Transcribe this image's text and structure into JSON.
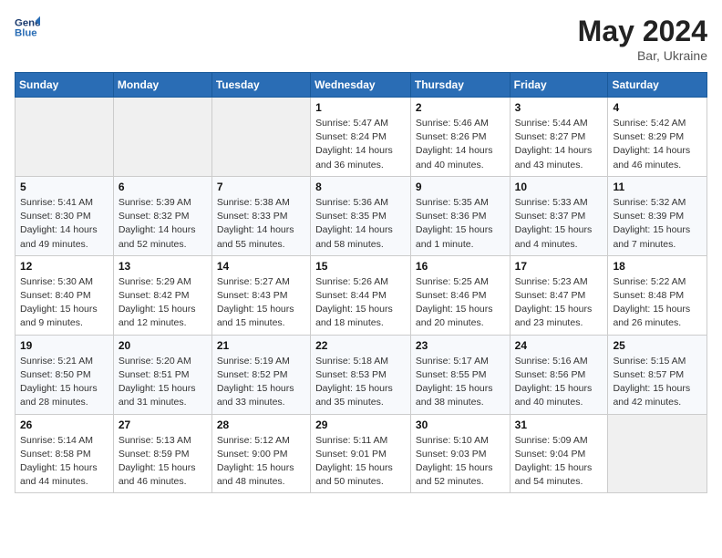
{
  "header": {
    "logo_line1": "General",
    "logo_line2": "Blue",
    "month_year": "May 2024",
    "location": "Bar, Ukraine"
  },
  "days_of_week": [
    "Sunday",
    "Monday",
    "Tuesday",
    "Wednesday",
    "Thursday",
    "Friday",
    "Saturday"
  ],
  "weeks": [
    [
      {
        "num": "",
        "info": ""
      },
      {
        "num": "",
        "info": ""
      },
      {
        "num": "",
        "info": ""
      },
      {
        "num": "1",
        "info": "Sunrise: 5:47 AM\nSunset: 8:24 PM\nDaylight: 14 hours\nand 36 minutes."
      },
      {
        "num": "2",
        "info": "Sunrise: 5:46 AM\nSunset: 8:26 PM\nDaylight: 14 hours\nand 40 minutes."
      },
      {
        "num": "3",
        "info": "Sunrise: 5:44 AM\nSunset: 8:27 PM\nDaylight: 14 hours\nand 43 minutes."
      },
      {
        "num": "4",
        "info": "Sunrise: 5:42 AM\nSunset: 8:29 PM\nDaylight: 14 hours\nand 46 minutes."
      }
    ],
    [
      {
        "num": "5",
        "info": "Sunrise: 5:41 AM\nSunset: 8:30 PM\nDaylight: 14 hours\nand 49 minutes."
      },
      {
        "num": "6",
        "info": "Sunrise: 5:39 AM\nSunset: 8:32 PM\nDaylight: 14 hours\nand 52 minutes."
      },
      {
        "num": "7",
        "info": "Sunrise: 5:38 AM\nSunset: 8:33 PM\nDaylight: 14 hours\nand 55 minutes."
      },
      {
        "num": "8",
        "info": "Sunrise: 5:36 AM\nSunset: 8:35 PM\nDaylight: 14 hours\nand 58 minutes."
      },
      {
        "num": "9",
        "info": "Sunrise: 5:35 AM\nSunset: 8:36 PM\nDaylight: 15 hours\nand 1 minute."
      },
      {
        "num": "10",
        "info": "Sunrise: 5:33 AM\nSunset: 8:37 PM\nDaylight: 15 hours\nand 4 minutes."
      },
      {
        "num": "11",
        "info": "Sunrise: 5:32 AM\nSunset: 8:39 PM\nDaylight: 15 hours\nand 7 minutes."
      }
    ],
    [
      {
        "num": "12",
        "info": "Sunrise: 5:30 AM\nSunset: 8:40 PM\nDaylight: 15 hours\nand 9 minutes."
      },
      {
        "num": "13",
        "info": "Sunrise: 5:29 AM\nSunset: 8:42 PM\nDaylight: 15 hours\nand 12 minutes."
      },
      {
        "num": "14",
        "info": "Sunrise: 5:27 AM\nSunset: 8:43 PM\nDaylight: 15 hours\nand 15 minutes."
      },
      {
        "num": "15",
        "info": "Sunrise: 5:26 AM\nSunset: 8:44 PM\nDaylight: 15 hours\nand 18 minutes."
      },
      {
        "num": "16",
        "info": "Sunrise: 5:25 AM\nSunset: 8:46 PM\nDaylight: 15 hours\nand 20 minutes."
      },
      {
        "num": "17",
        "info": "Sunrise: 5:23 AM\nSunset: 8:47 PM\nDaylight: 15 hours\nand 23 minutes."
      },
      {
        "num": "18",
        "info": "Sunrise: 5:22 AM\nSunset: 8:48 PM\nDaylight: 15 hours\nand 26 minutes."
      }
    ],
    [
      {
        "num": "19",
        "info": "Sunrise: 5:21 AM\nSunset: 8:50 PM\nDaylight: 15 hours\nand 28 minutes."
      },
      {
        "num": "20",
        "info": "Sunrise: 5:20 AM\nSunset: 8:51 PM\nDaylight: 15 hours\nand 31 minutes."
      },
      {
        "num": "21",
        "info": "Sunrise: 5:19 AM\nSunset: 8:52 PM\nDaylight: 15 hours\nand 33 minutes."
      },
      {
        "num": "22",
        "info": "Sunrise: 5:18 AM\nSunset: 8:53 PM\nDaylight: 15 hours\nand 35 minutes."
      },
      {
        "num": "23",
        "info": "Sunrise: 5:17 AM\nSunset: 8:55 PM\nDaylight: 15 hours\nand 38 minutes."
      },
      {
        "num": "24",
        "info": "Sunrise: 5:16 AM\nSunset: 8:56 PM\nDaylight: 15 hours\nand 40 minutes."
      },
      {
        "num": "25",
        "info": "Sunrise: 5:15 AM\nSunset: 8:57 PM\nDaylight: 15 hours\nand 42 minutes."
      }
    ],
    [
      {
        "num": "26",
        "info": "Sunrise: 5:14 AM\nSunset: 8:58 PM\nDaylight: 15 hours\nand 44 minutes."
      },
      {
        "num": "27",
        "info": "Sunrise: 5:13 AM\nSunset: 8:59 PM\nDaylight: 15 hours\nand 46 minutes."
      },
      {
        "num": "28",
        "info": "Sunrise: 5:12 AM\nSunset: 9:00 PM\nDaylight: 15 hours\nand 48 minutes."
      },
      {
        "num": "29",
        "info": "Sunrise: 5:11 AM\nSunset: 9:01 PM\nDaylight: 15 hours\nand 50 minutes."
      },
      {
        "num": "30",
        "info": "Sunrise: 5:10 AM\nSunset: 9:03 PM\nDaylight: 15 hours\nand 52 minutes."
      },
      {
        "num": "31",
        "info": "Sunrise: 5:09 AM\nSunset: 9:04 PM\nDaylight: 15 hours\nand 54 minutes."
      },
      {
        "num": "",
        "info": ""
      }
    ]
  ]
}
